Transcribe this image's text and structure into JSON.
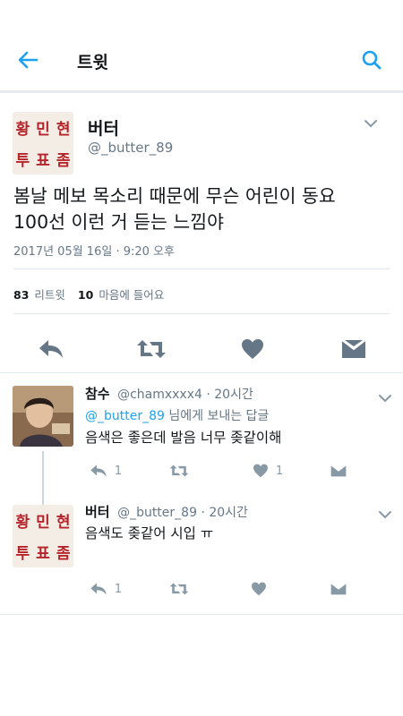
{
  "header": {
    "title": "트윗",
    "back_icon": "arrow-left-icon",
    "search_icon": "search-icon",
    "accent": "#1da1f2"
  },
  "main_tweet": {
    "badge": {
      "row1": [
        "황",
        "민",
        "현"
      ],
      "row2": [
        "투",
        "표",
        "좀"
      ]
    },
    "name": "버터",
    "handle": "@_butter_89",
    "text_line1": "봄날 메보 목소리 때문에 무슨 어린이 동요",
    "text_line2": "100선 이런 거 듣는 느낌야",
    "timestamp": "2017년 05월 16일 · 9:20 오후",
    "retweets_count": "83",
    "retweets_label": "리트윗",
    "likes_count": "10",
    "likes_label": "마음에 들어요"
  },
  "replies": [
    {
      "name": "참수",
      "handle": "@chamxxxx4",
      "time": "· 20시간",
      "replying_mention": "@_butter_89",
      "replying_suffix": " 님에게 보내는 답글",
      "text": "음색은 좋은데 발음 너무 좆같이해",
      "reply_count": "1",
      "like_count": "1"
    },
    {
      "badge": {
        "row1": [
          "황",
          "민",
          "현"
        ],
        "row2": [
          "투",
          "표",
          "좀"
        ]
      },
      "name": "버터",
      "handle": "@_butter_89",
      "time": "· 20시간",
      "text": "음색도 좆같어 시입 ㅠ",
      "reply_count": "1"
    }
  ]
}
